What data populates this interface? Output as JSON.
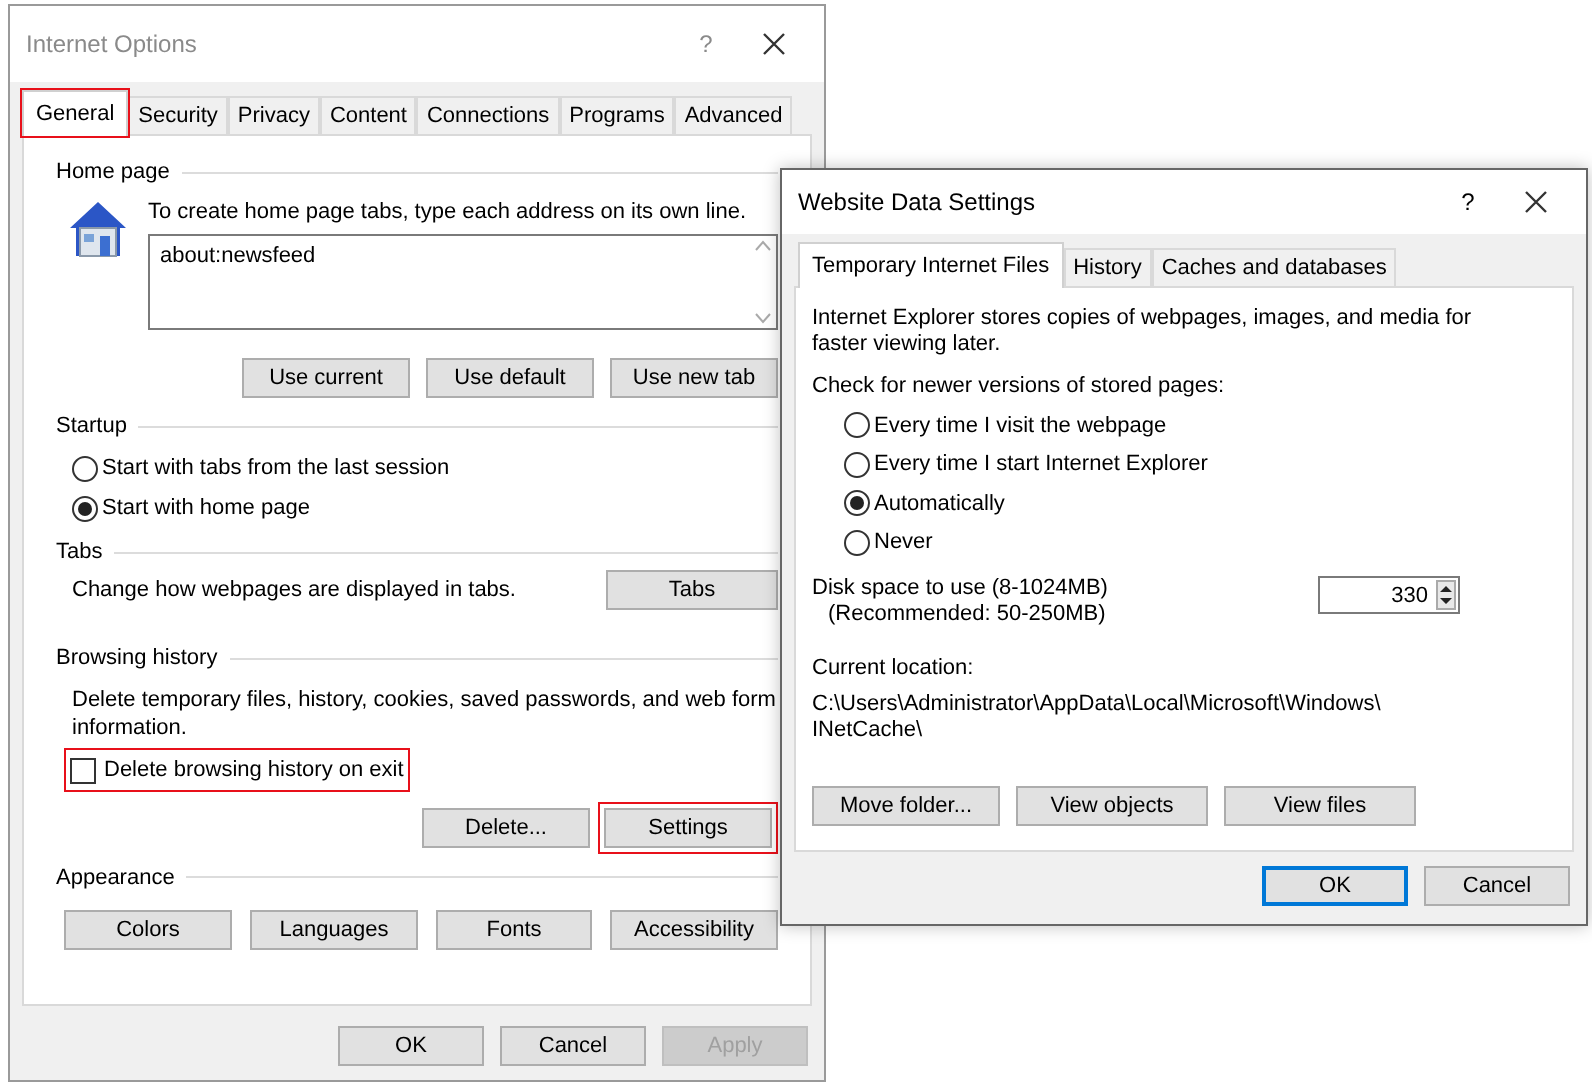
{
  "internet_options": {
    "title": "Internet Options",
    "help": "?",
    "tabs": [
      {
        "label": "General",
        "selected": true,
        "highlighted": true
      },
      {
        "label": "Security",
        "selected": false,
        "highlighted": false
      },
      {
        "label": "Privacy",
        "selected": false,
        "highlighted": false
      },
      {
        "label": "Content",
        "selected": false,
        "highlighted": false
      },
      {
        "label": "Connections",
        "selected": false,
        "highlighted": false
      },
      {
        "label": "Programs",
        "selected": false,
        "highlighted": false
      },
      {
        "label": "Advanced",
        "selected": false,
        "highlighted": false
      }
    ],
    "home_page": {
      "legend": "Home page",
      "hint": "To create home page tabs, type each address on its own line.",
      "addresses": "about:newsfeed",
      "buttons": [
        "Use current",
        "Use default",
        "Use new tab"
      ]
    },
    "startup": {
      "legend": "Startup",
      "options": [
        {
          "label": "Start with tabs from the last session",
          "selected": false
        },
        {
          "label": "Start with home page",
          "selected": true
        }
      ]
    },
    "tabs_group": {
      "legend": "Tabs",
      "text": "Change how webpages are displayed in tabs.",
      "button": "Tabs"
    },
    "browsing_history": {
      "legend": "Browsing history",
      "text": "Delete temporary files, history, cookies, saved passwords, and web form information.",
      "checkbox": {
        "label": "Delete browsing history on exit",
        "checked": false,
        "highlighted": true
      },
      "buttons": [
        {
          "label": "Delete...",
          "highlighted": false
        },
        {
          "label": "Settings",
          "highlighted": true
        }
      ]
    },
    "appearance": {
      "legend": "Appearance",
      "buttons": [
        "Colors",
        "Languages",
        "Fonts",
        "Accessibility"
      ]
    },
    "footer_buttons": [
      {
        "label": "OK",
        "disabled": false
      },
      {
        "label": "Cancel",
        "disabled": false
      },
      {
        "label": "Apply",
        "disabled": true
      }
    ]
  },
  "website_data_settings": {
    "title": "Website Data Settings",
    "help": "?",
    "tabs": [
      {
        "label": "Temporary Internet Files",
        "selected": true
      },
      {
        "label": "History",
        "selected": false
      },
      {
        "label": "Caches and databases",
        "selected": false
      }
    ],
    "description": "Internet Explorer stores copies of webpages, images, and media for faster viewing later.",
    "check_label": "Check for newer versions of stored pages:",
    "options": [
      {
        "label": "Every time I visit the webpage",
        "selected": false
      },
      {
        "label": "Every time I start Internet Explorer",
        "selected": false
      },
      {
        "label": "Automatically",
        "selected": true
      },
      {
        "label": "Never",
        "selected": false
      }
    ],
    "disk_space_label": "Disk space to use (8-1024MB)",
    "disk_space_hint": "(Recommended: 50-250MB)",
    "disk_space_value": "330",
    "location_label": "Current location:",
    "location_lines": [
      "C:\\Users\\Administrator\\AppData\\Local\\Microsoft\\Windows\\",
      "INetCache\\"
    ],
    "buttons": [
      "Move folder...",
      "View objects",
      "View files"
    ],
    "footer_buttons": [
      {
        "label": "OK",
        "default": true
      },
      {
        "label": "Cancel",
        "default": false
      }
    ]
  }
}
